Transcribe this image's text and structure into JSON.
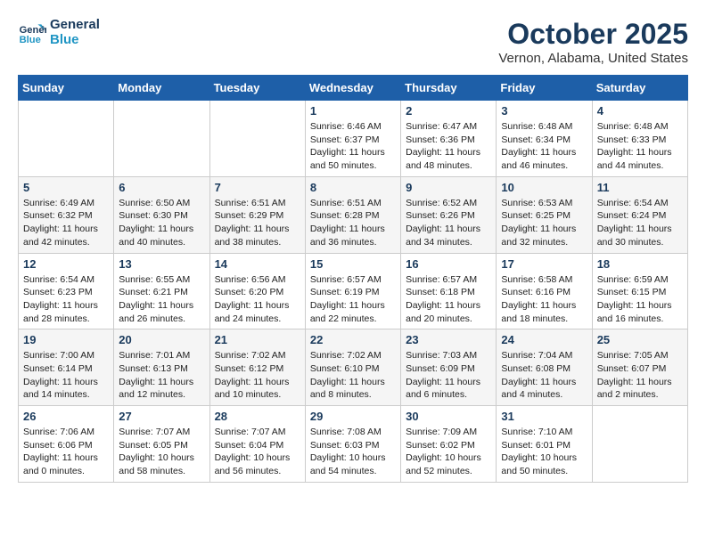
{
  "header": {
    "logo_line1": "General",
    "logo_line2": "Blue",
    "title": "October 2025",
    "subtitle": "Vernon, Alabama, United States"
  },
  "days_of_week": [
    "Sunday",
    "Monday",
    "Tuesday",
    "Wednesday",
    "Thursday",
    "Friday",
    "Saturday"
  ],
  "weeks": [
    [
      {
        "day": "",
        "info": ""
      },
      {
        "day": "",
        "info": ""
      },
      {
        "day": "",
        "info": ""
      },
      {
        "day": "1",
        "info": "Sunrise: 6:46 AM\nSunset: 6:37 PM\nDaylight: 11 hours\nand 50 minutes."
      },
      {
        "day": "2",
        "info": "Sunrise: 6:47 AM\nSunset: 6:36 PM\nDaylight: 11 hours\nand 48 minutes."
      },
      {
        "day": "3",
        "info": "Sunrise: 6:48 AM\nSunset: 6:34 PM\nDaylight: 11 hours\nand 46 minutes."
      },
      {
        "day": "4",
        "info": "Sunrise: 6:48 AM\nSunset: 6:33 PM\nDaylight: 11 hours\nand 44 minutes."
      }
    ],
    [
      {
        "day": "5",
        "info": "Sunrise: 6:49 AM\nSunset: 6:32 PM\nDaylight: 11 hours\nand 42 minutes."
      },
      {
        "day": "6",
        "info": "Sunrise: 6:50 AM\nSunset: 6:30 PM\nDaylight: 11 hours\nand 40 minutes."
      },
      {
        "day": "7",
        "info": "Sunrise: 6:51 AM\nSunset: 6:29 PM\nDaylight: 11 hours\nand 38 minutes."
      },
      {
        "day": "8",
        "info": "Sunrise: 6:51 AM\nSunset: 6:28 PM\nDaylight: 11 hours\nand 36 minutes."
      },
      {
        "day": "9",
        "info": "Sunrise: 6:52 AM\nSunset: 6:26 PM\nDaylight: 11 hours\nand 34 minutes."
      },
      {
        "day": "10",
        "info": "Sunrise: 6:53 AM\nSunset: 6:25 PM\nDaylight: 11 hours\nand 32 minutes."
      },
      {
        "day": "11",
        "info": "Sunrise: 6:54 AM\nSunset: 6:24 PM\nDaylight: 11 hours\nand 30 minutes."
      }
    ],
    [
      {
        "day": "12",
        "info": "Sunrise: 6:54 AM\nSunset: 6:23 PM\nDaylight: 11 hours\nand 28 minutes."
      },
      {
        "day": "13",
        "info": "Sunrise: 6:55 AM\nSunset: 6:21 PM\nDaylight: 11 hours\nand 26 minutes."
      },
      {
        "day": "14",
        "info": "Sunrise: 6:56 AM\nSunset: 6:20 PM\nDaylight: 11 hours\nand 24 minutes."
      },
      {
        "day": "15",
        "info": "Sunrise: 6:57 AM\nSunset: 6:19 PM\nDaylight: 11 hours\nand 22 minutes."
      },
      {
        "day": "16",
        "info": "Sunrise: 6:57 AM\nSunset: 6:18 PM\nDaylight: 11 hours\nand 20 minutes."
      },
      {
        "day": "17",
        "info": "Sunrise: 6:58 AM\nSunset: 6:16 PM\nDaylight: 11 hours\nand 18 minutes."
      },
      {
        "day": "18",
        "info": "Sunrise: 6:59 AM\nSunset: 6:15 PM\nDaylight: 11 hours\nand 16 minutes."
      }
    ],
    [
      {
        "day": "19",
        "info": "Sunrise: 7:00 AM\nSunset: 6:14 PM\nDaylight: 11 hours\nand 14 minutes."
      },
      {
        "day": "20",
        "info": "Sunrise: 7:01 AM\nSunset: 6:13 PM\nDaylight: 11 hours\nand 12 minutes."
      },
      {
        "day": "21",
        "info": "Sunrise: 7:02 AM\nSunset: 6:12 PM\nDaylight: 11 hours\nand 10 minutes."
      },
      {
        "day": "22",
        "info": "Sunrise: 7:02 AM\nSunset: 6:10 PM\nDaylight: 11 hours\nand 8 minutes."
      },
      {
        "day": "23",
        "info": "Sunrise: 7:03 AM\nSunset: 6:09 PM\nDaylight: 11 hours\nand 6 minutes."
      },
      {
        "day": "24",
        "info": "Sunrise: 7:04 AM\nSunset: 6:08 PM\nDaylight: 11 hours\nand 4 minutes."
      },
      {
        "day": "25",
        "info": "Sunrise: 7:05 AM\nSunset: 6:07 PM\nDaylight: 11 hours\nand 2 minutes."
      }
    ],
    [
      {
        "day": "26",
        "info": "Sunrise: 7:06 AM\nSunset: 6:06 PM\nDaylight: 11 hours\nand 0 minutes."
      },
      {
        "day": "27",
        "info": "Sunrise: 7:07 AM\nSunset: 6:05 PM\nDaylight: 10 hours\nand 58 minutes."
      },
      {
        "day": "28",
        "info": "Sunrise: 7:07 AM\nSunset: 6:04 PM\nDaylight: 10 hours\nand 56 minutes."
      },
      {
        "day": "29",
        "info": "Sunrise: 7:08 AM\nSunset: 6:03 PM\nDaylight: 10 hours\nand 54 minutes."
      },
      {
        "day": "30",
        "info": "Sunrise: 7:09 AM\nSunset: 6:02 PM\nDaylight: 10 hours\nand 52 minutes."
      },
      {
        "day": "31",
        "info": "Sunrise: 7:10 AM\nSunset: 6:01 PM\nDaylight: 10 hours\nand 50 minutes."
      },
      {
        "day": "",
        "info": ""
      }
    ]
  ]
}
